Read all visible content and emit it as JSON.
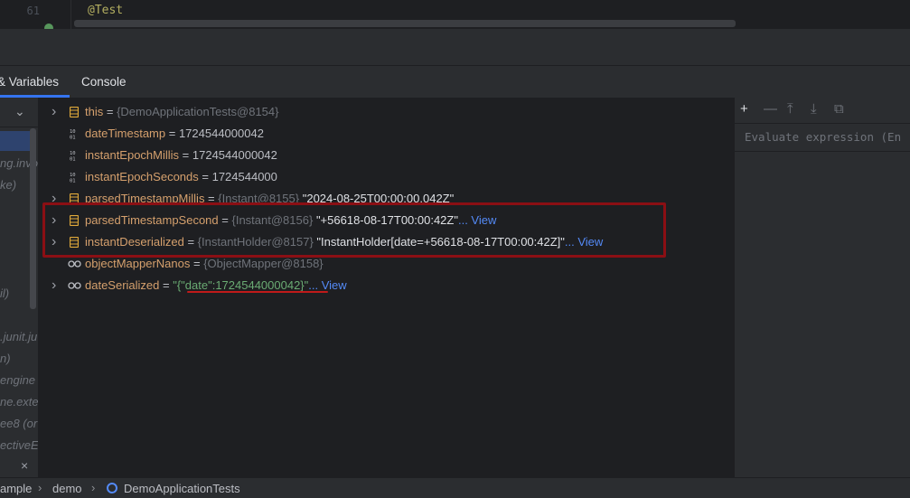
{
  "editor": {
    "line_number": "61",
    "code_line": "@Test"
  },
  "tabs": [
    {
      "label": "& Variables"
    },
    {
      "label": "Console"
    }
  ],
  "frames": {
    "items": [
      "ng.invo",
      "ke)",
      "il)",
      ".junit.ju",
      "n)",
      "engine",
      "ne.exte",
      "ee8 (or",
      "ectiveE"
    ]
  },
  "variables": [
    {
      "name": "this",
      "type": "{DemoApplicationTests@8154}",
      "value": "",
      "expandable": true,
      "icon": "field-icon"
    },
    {
      "name": "dateTimestamp",
      "type": "",
      "value": "1724544000042",
      "expandable": false,
      "icon": "primitive-icon"
    },
    {
      "name": "instantEpochMillis",
      "type": "",
      "value": "1724544000042",
      "expandable": false,
      "icon": "primitive-icon"
    },
    {
      "name": "instantEpochSeconds",
      "type": "",
      "value": "1724544000",
      "expandable": false,
      "icon": "primitive-icon"
    },
    {
      "name": "parsedTimestampMillis",
      "type": "{Instant@8155}",
      "value": "\"2024-08-25T00:00:00.042Z\"",
      "expandable": true,
      "icon": "field-icon"
    },
    {
      "name": "parsedTimestampSecond",
      "type": "{Instant@8156}",
      "value": "\"+56618-08-17T00:00:42Z\"",
      "link": "... View",
      "expandable": true,
      "icon": "field-icon"
    },
    {
      "name": "instantDeserialized",
      "type": "{InstantHolder@8157}",
      "value": "\"InstantHolder[date=+56618-08-17T00:00:42Z]\"",
      "link": "... View",
      "expandable": true,
      "icon": "field-icon"
    },
    {
      "name": "objectMapperNanos",
      "type": "{ObjectMapper@8158}",
      "value": "",
      "expandable": false,
      "icon": "watch-icon"
    },
    {
      "name": "dateSerialized",
      "type": "",
      "value": "\"{\"date\":1724544000042}\"",
      "link": "... View",
      "expandable": true,
      "icon": "watch-icon"
    }
  ],
  "evaluate": {
    "placeholder": "Evaluate expression (En"
  },
  "status": {
    "crumbs": [
      "ample",
      "demo",
      "DemoApplicationTests"
    ]
  },
  "colors": {
    "accent": "#3574f0",
    "highlight_box": "#8b0f14",
    "string": "#6aab73",
    "link": "#548af7"
  }
}
